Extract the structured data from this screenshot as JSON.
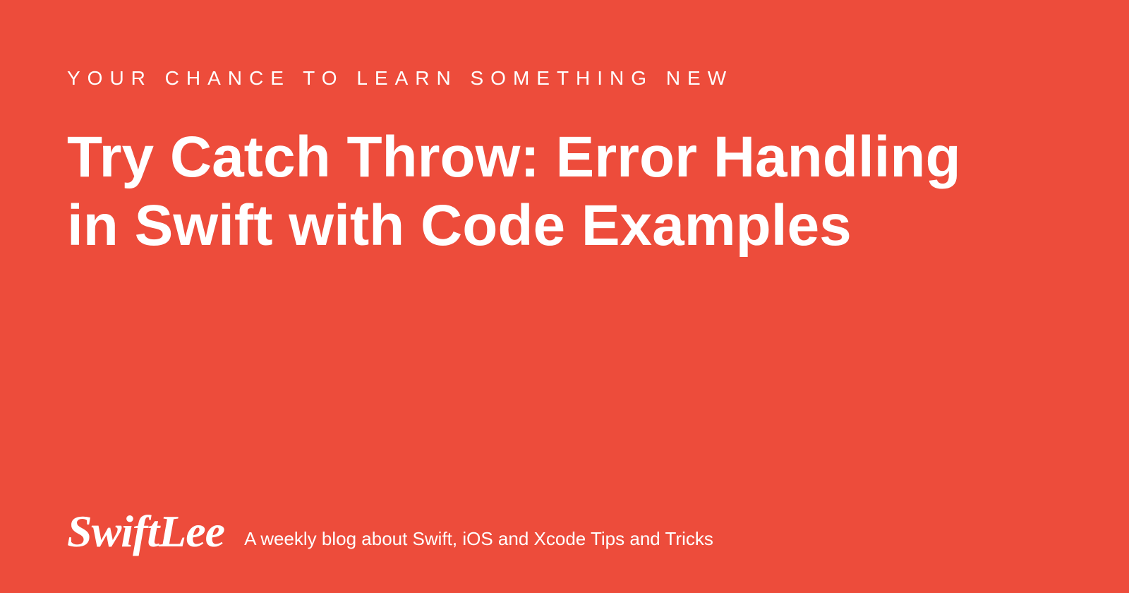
{
  "overline": "YOUR CHANCE TO LEARN SOMETHING NEW",
  "title": "Try Catch Throw: Error Handling in Swift with Code Examples",
  "footer": {
    "logo": "SwiftLee",
    "tagline": "A weekly blog about Swift, iOS and Xcode Tips and Tricks"
  },
  "colors": {
    "background": "#ed4c3b",
    "text": "#ffffff"
  }
}
